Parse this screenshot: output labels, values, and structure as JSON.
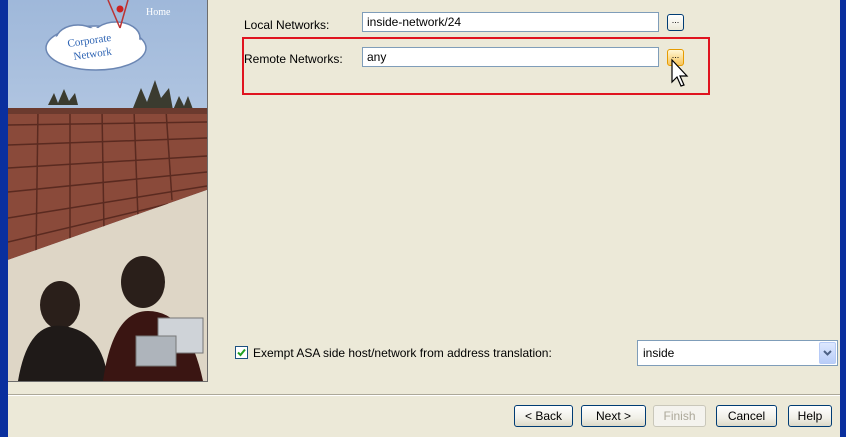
{
  "form": {
    "local_networks_label": "Local Networks:",
    "local_networks_value": "inside-network/24",
    "remote_networks_label": "Remote Networks:",
    "remote_networks_value": "any",
    "browse_label": "...",
    "exempt_checked": true,
    "exempt_label": "Exempt ASA side host/network from address translation:",
    "interface_value": "inside"
  },
  "art": {
    "home_label": "Home",
    "corporate_label_1": "Corporate",
    "corporate_label_2": "Network"
  },
  "footer": {
    "back_label": "< Back",
    "next_label": "Next >",
    "finish_label": "Finish",
    "cancel_label": "Cancel",
    "help_label": "Help"
  },
  "colors": {
    "highlight": "#e0141f",
    "dialog_bg": "#ece9d8",
    "frame": "#0a2f9e"
  }
}
